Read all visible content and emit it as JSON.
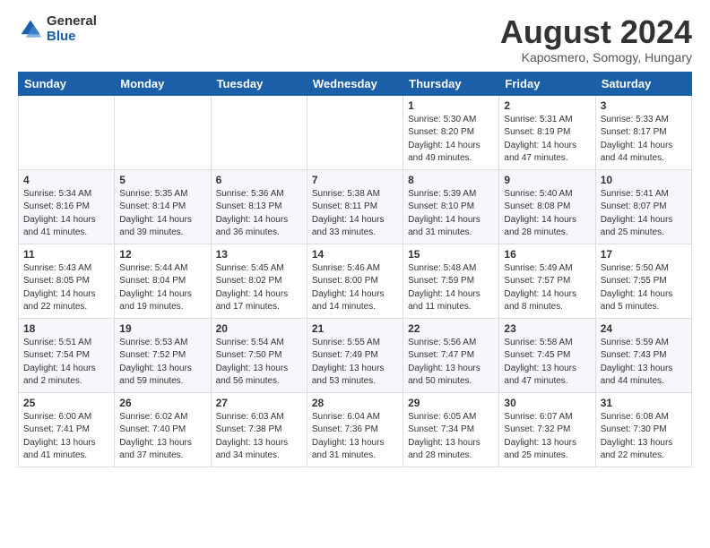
{
  "header": {
    "logo_general": "General",
    "logo_blue": "Blue",
    "month_year": "August 2024",
    "location": "Kaposmero, Somogy, Hungary"
  },
  "weekdays": [
    "Sunday",
    "Monday",
    "Tuesday",
    "Wednesday",
    "Thursday",
    "Friday",
    "Saturday"
  ],
  "weeks": [
    [
      {
        "day": "",
        "info": ""
      },
      {
        "day": "",
        "info": ""
      },
      {
        "day": "",
        "info": ""
      },
      {
        "day": "",
        "info": ""
      },
      {
        "day": "1",
        "info": "Sunrise: 5:30 AM\nSunset: 8:20 PM\nDaylight: 14 hours\nand 49 minutes."
      },
      {
        "day": "2",
        "info": "Sunrise: 5:31 AM\nSunset: 8:19 PM\nDaylight: 14 hours\nand 47 minutes."
      },
      {
        "day": "3",
        "info": "Sunrise: 5:33 AM\nSunset: 8:17 PM\nDaylight: 14 hours\nand 44 minutes."
      }
    ],
    [
      {
        "day": "4",
        "info": "Sunrise: 5:34 AM\nSunset: 8:16 PM\nDaylight: 14 hours\nand 41 minutes."
      },
      {
        "day": "5",
        "info": "Sunrise: 5:35 AM\nSunset: 8:14 PM\nDaylight: 14 hours\nand 39 minutes."
      },
      {
        "day": "6",
        "info": "Sunrise: 5:36 AM\nSunset: 8:13 PM\nDaylight: 14 hours\nand 36 minutes."
      },
      {
        "day": "7",
        "info": "Sunrise: 5:38 AM\nSunset: 8:11 PM\nDaylight: 14 hours\nand 33 minutes."
      },
      {
        "day": "8",
        "info": "Sunrise: 5:39 AM\nSunset: 8:10 PM\nDaylight: 14 hours\nand 31 minutes."
      },
      {
        "day": "9",
        "info": "Sunrise: 5:40 AM\nSunset: 8:08 PM\nDaylight: 14 hours\nand 28 minutes."
      },
      {
        "day": "10",
        "info": "Sunrise: 5:41 AM\nSunset: 8:07 PM\nDaylight: 14 hours\nand 25 minutes."
      }
    ],
    [
      {
        "day": "11",
        "info": "Sunrise: 5:43 AM\nSunset: 8:05 PM\nDaylight: 14 hours\nand 22 minutes."
      },
      {
        "day": "12",
        "info": "Sunrise: 5:44 AM\nSunset: 8:04 PM\nDaylight: 14 hours\nand 19 minutes."
      },
      {
        "day": "13",
        "info": "Sunrise: 5:45 AM\nSunset: 8:02 PM\nDaylight: 14 hours\nand 17 minutes."
      },
      {
        "day": "14",
        "info": "Sunrise: 5:46 AM\nSunset: 8:00 PM\nDaylight: 14 hours\nand 14 minutes."
      },
      {
        "day": "15",
        "info": "Sunrise: 5:48 AM\nSunset: 7:59 PM\nDaylight: 14 hours\nand 11 minutes."
      },
      {
        "day": "16",
        "info": "Sunrise: 5:49 AM\nSunset: 7:57 PM\nDaylight: 14 hours\nand 8 minutes."
      },
      {
        "day": "17",
        "info": "Sunrise: 5:50 AM\nSunset: 7:55 PM\nDaylight: 14 hours\nand 5 minutes."
      }
    ],
    [
      {
        "day": "18",
        "info": "Sunrise: 5:51 AM\nSunset: 7:54 PM\nDaylight: 14 hours\nand 2 minutes."
      },
      {
        "day": "19",
        "info": "Sunrise: 5:53 AM\nSunset: 7:52 PM\nDaylight: 13 hours\nand 59 minutes."
      },
      {
        "day": "20",
        "info": "Sunrise: 5:54 AM\nSunset: 7:50 PM\nDaylight: 13 hours\nand 56 minutes."
      },
      {
        "day": "21",
        "info": "Sunrise: 5:55 AM\nSunset: 7:49 PM\nDaylight: 13 hours\nand 53 minutes."
      },
      {
        "day": "22",
        "info": "Sunrise: 5:56 AM\nSunset: 7:47 PM\nDaylight: 13 hours\nand 50 minutes."
      },
      {
        "day": "23",
        "info": "Sunrise: 5:58 AM\nSunset: 7:45 PM\nDaylight: 13 hours\nand 47 minutes."
      },
      {
        "day": "24",
        "info": "Sunrise: 5:59 AM\nSunset: 7:43 PM\nDaylight: 13 hours\nand 44 minutes."
      }
    ],
    [
      {
        "day": "25",
        "info": "Sunrise: 6:00 AM\nSunset: 7:41 PM\nDaylight: 13 hours\nand 41 minutes."
      },
      {
        "day": "26",
        "info": "Sunrise: 6:02 AM\nSunset: 7:40 PM\nDaylight: 13 hours\nand 37 minutes."
      },
      {
        "day": "27",
        "info": "Sunrise: 6:03 AM\nSunset: 7:38 PM\nDaylight: 13 hours\nand 34 minutes."
      },
      {
        "day": "28",
        "info": "Sunrise: 6:04 AM\nSunset: 7:36 PM\nDaylight: 13 hours\nand 31 minutes."
      },
      {
        "day": "29",
        "info": "Sunrise: 6:05 AM\nSunset: 7:34 PM\nDaylight: 13 hours\nand 28 minutes."
      },
      {
        "day": "30",
        "info": "Sunrise: 6:07 AM\nSunset: 7:32 PM\nDaylight: 13 hours\nand 25 minutes."
      },
      {
        "day": "31",
        "info": "Sunrise: 6:08 AM\nSunset: 7:30 PM\nDaylight: 13 hours\nand 22 minutes."
      }
    ]
  ]
}
